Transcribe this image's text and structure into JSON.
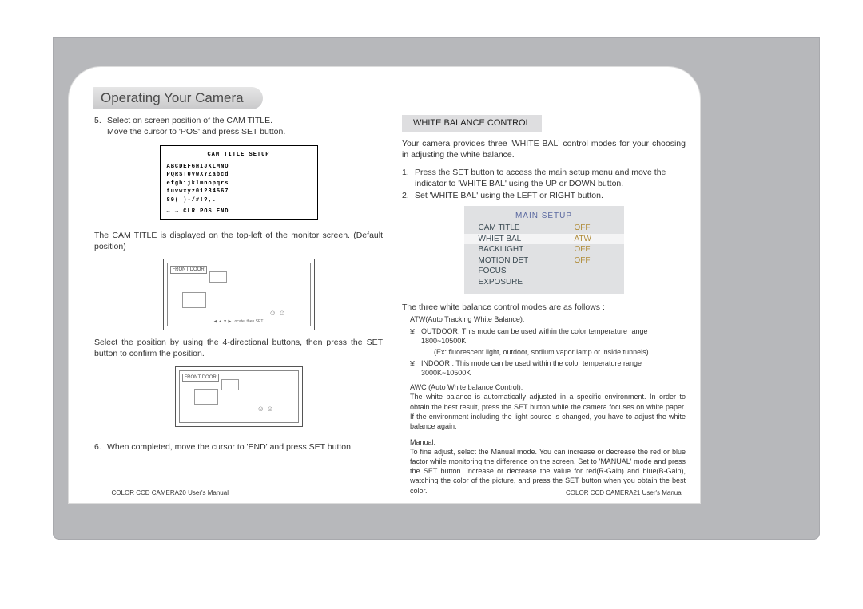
{
  "header": {
    "title": "Operating Your Camera"
  },
  "left": {
    "step5_num": "5.",
    "step5a": "Select on screen position of the CAM TITLE.",
    "step5b": "Move the cursor to 'POS' and press SET button.",
    "osd": {
      "title": "CAM TITLE SETUP",
      "row1": "ABCDEFGHIJKLMNO",
      "row2": "PQRSTUVWXYZabcd",
      "row3": "efghijklmnopqrs",
      "row4": "tuvwxyz01234567",
      "row5": "89( )-/#!?,.",
      "row6": "← → CLR POS END"
    },
    "para2": "The CAM TITLE is displayed on the top-left of the monitor screen. (Default position)",
    "front_door": "FRONT DOOR",
    "illus_footer": "◀ ▲ ▼ ▶ Locate, then SET",
    "para3": "Select the position by using the 4-directional buttons, then press the SET button to confirm the position.",
    "step6_num": "6.",
    "step6": "When completed, move the cursor to 'END' and press SET button.",
    "footer": "COLOR CCD CAMERA20   User's Manual"
  },
  "right": {
    "section": "WHITE BALANCE CONTROL",
    "para1": "Your camera provides three 'WHITE BAL' control modes for your choosing in adjusting the white balance.",
    "step1_num": "1.",
    "step1": "Press the SET button to access the main setup menu and move the indicator to 'WHITE BAL' using the UP or DOWN button.",
    "step2_num": "2.",
    "step2": "Set 'WHITE BAL' using the LEFT or RIGHT button.",
    "menu": {
      "title": "MAIN SETUP",
      "rows": [
        {
          "k": "CAM TITLE",
          "v": "OFF"
        },
        {
          "k": "WHIET BAL",
          "v": "ATW"
        },
        {
          "k": "BACKLIGHT",
          "v": "OFF"
        },
        {
          "k": "MOTION DET",
          "v": "OFF"
        },
        {
          "k": "FOCUS",
          "v": ""
        },
        {
          "k": "EXPOSURE",
          "v": ""
        }
      ]
    },
    "para2": "The three white balance control modes are as follows :",
    "mode1_head": "ATW(Auto Tracking White Balance):",
    "mode1_b1_sym": "¥",
    "mode1_b1": "OUTDOOR: This mode can be used within the color temperature range 1800~10500K",
    "mode1_ex": "(Ex: fluorescent light, outdoor, sodium vapor lamp or inside tunnels)",
    "mode1_b2_sym": "¥",
    "mode1_b2": "INDOOR : This mode can be used within the color temperature range 3000K~10500K",
    "mode2_head": "AWC (Auto White balance Control):",
    "mode2_body": "The white balance is automatically adjusted in a specific environment. In order to obtain the best result, press the SET button while the camera focuses on white paper. If the environment including the light source is changed, you have to adjust the white balance again.",
    "mode3_head": "Manual:",
    "mode3_body": "To fine adjust, select the Manual mode. You can increase or decrease the red or blue factor while monitoring the difference on the screen. Set to 'MANUAL' mode and press the SET button. Increase or decrease the value for red(R-Gain) and blue(B-Gain), watching the color of the picture, and press the SET button when you obtain the best color.",
    "footer": "COLOR CCD CAMERA21   User's Manual"
  }
}
